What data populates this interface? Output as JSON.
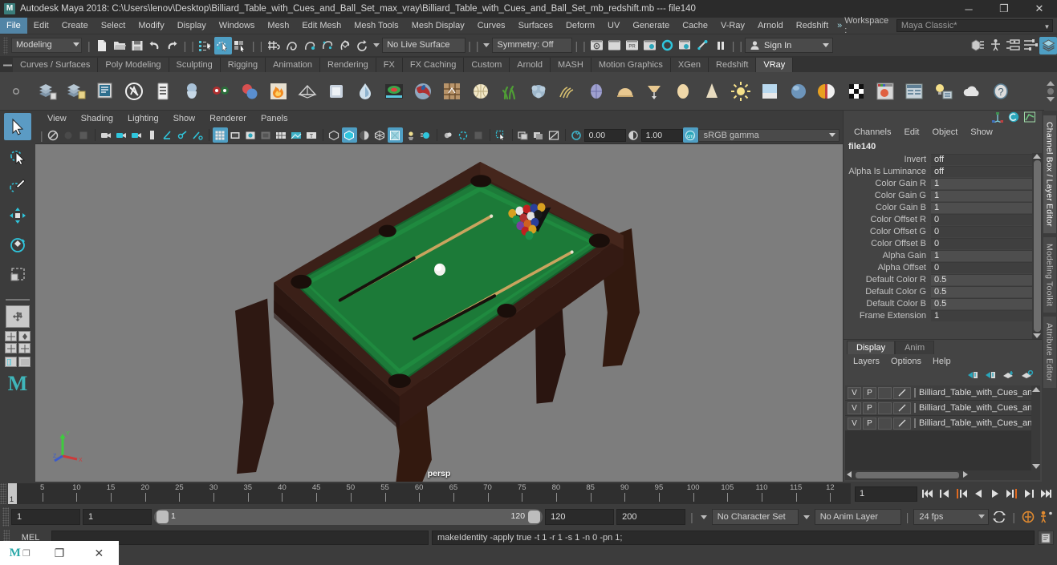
{
  "titlebar": {
    "app_icon": "maya-logo-icon",
    "title": "Autodesk Maya 2018: C:\\Users\\lenov\\Desktop\\Billiard_Table_with_Cues_and_Ball_Set_max_vray\\Billiard_Table_with_Cues_and_Ball_Set_mb_redshift.mb   ---  file140",
    "minimize": "─",
    "maximize": "❐",
    "close": "✕"
  },
  "menubar": {
    "items": [
      "File",
      "Edit",
      "Create",
      "Select",
      "Modify",
      "Display",
      "Windows",
      "Mesh",
      "Edit Mesh",
      "Mesh Tools",
      "Mesh Display",
      "Curves",
      "Surfaces",
      "Deform",
      "UV",
      "Generate",
      "Cache",
      "V-Ray",
      "Arnold",
      "Redshift"
    ],
    "active_index": 0,
    "overflow_chevron": "»",
    "workspace_label": "Workspace :",
    "workspace_value": "Maya Classic*",
    "lock_icon": "lock-icon"
  },
  "statusline": {
    "menuset": "Modeling",
    "no_live_surface": "No Live Surface",
    "symmetry": "Symmetry: Off",
    "signin": "Sign In",
    "icons": [
      "new-scene-icon",
      "open-scene-icon",
      "save-scene-icon",
      "undo-icon",
      "redo-icon",
      "select-by-hierarchy-icon",
      "select-by-object-icon",
      "select-by-component-icon",
      "snap-to-grid-icon",
      "snap-to-curve-icon",
      "snap-to-point-icon",
      "snap-to-projected-center-icon",
      "snap-to-view-plane-icon",
      "make-live-icon",
      "render-current-frame-icon",
      "ipr-render-icon",
      "render-settings-icon",
      "hypershade-icon",
      "render-view-icon",
      "render-sequence-icon",
      "pause-icon",
      "show-hide-editors-icon",
      "character-icon",
      "attribute-editor-icon",
      "tool-settings-icon",
      "channel-box-icon"
    ]
  },
  "shelf": {
    "tabs": [
      "Curves / Surfaces",
      "Poly Modeling",
      "Sculpting",
      "Rigging",
      "Animation",
      "Rendering",
      "FX",
      "FX Caching",
      "Custom",
      "Arnold",
      "MASH",
      "Motion Graphics",
      "XGen",
      "Redshift",
      "VRay"
    ],
    "active_tab": "VRay",
    "items": [
      {
        "name": "vray-render-icon"
      },
      {
        "name": "vray-render-save-icon"
      },
      {
        "name": "vray-frame-buffer-icon"
      },
      {
        "name": "vray-settings-icon"
      },
      {
        "name": "vray-vfb-icon"
      },
      {
        "name": "vray-proxy-icon"
      },
      {
        "name": "vray-stereo-icon"
      },
      {
        "name": "vray-material-icon"
      },
      {
        "name": "vray-fire-icon"
      },
      {
        "name": "vray-mesh-light-icon"
      },
      {
        "name": "vray-plane-icon"
      },
      {
        "name": "vray-water-icon"
      },
      {
        "name": "vray-displacement-icon"
      },
      {
        "name": "vray-blend-material-icon"
      },
      {
        "name": "vray-grid-icon"
      },
      {
        "name": "vray-dome-light-icon"
      },
      {
        "name": "vray-grass-icon"
      },
      {
        "name": "vray-fur-icon"
      },
      {
        "name": "vray-hair-icon"
      },
      {
        "name": "vray-sphere-light-icon"
      },
      {
        "name": "vray-dome-icon"
      },
      {
        "name": "vray-ies-light-icon"
      },
      {
        "name": "vray-sphere-icon"
      },
      {
        "name": "vray-cone-light-icon"
      },
      {
        "name": "vray-sun-icon"
      },
      {
        "name": "vray-sky-icon"
      },
      {
        "name": "vray-ball-icon"
      },
      {
        "name": "vray-toon-icon"
      },
      {
        "name": "vray-checker-icon"
      },
      {
        "name": "vray-material-preview-icon"
      },
      {
        "name": "vray-render-elements-icon"
      },
      {
        "name": "vray-light-lister-icon"
      },
      {
        "name": "vray-cloud-icon"
      },
      {
        "name": "vray-help-icon"
      }
    ]
  },
  "toolbox": {
    "tools": [
      "select-tool",
      "lasso-select-tool",
      "paint-select-tool",
      "move-tool",
      "rotate-tool",
      "scale-tool"
    ],
    "active_tool": "select-tool",
    "quick_layout": "single-perspective-layout-icon",
    "layout_cells": [
      "four-view-layout",
      "persp-outliner-layout",
      "persp-graph-layout",
      "persp-hypershade-layout"
    ],
    "maya_logo": "M"
  },
  "viewport": {
    "menus": [
      "View",
      "Shading",
      "Lighting",
      "Show",
      "Renderer",
      "Panels"
    ],
    "camera_label": "persp",
    "exposure": "0.00",
    "gamma": "1.00",
    "color_space": "sRGB gamma",
    "toolbar_icons": [
      "select-camera-icon",
      "lock-camera-icon",
      "camera-attributes-icon",
      "bookmark-icon",
      "image-plane-icon",
      "two-d-pan-zoom-icon",
      "grease-pencil-icon",
      "grid-toggle-icon",
      "film-gate-icon",
      "resolution-gate-icon",
      "gate-mask-icon",
      "wireframe-on-shaded-icon",
      "xray-icon",
      "xray-joints-icon",
      "shaded-icon",
      "smooth-shade-icon",
      "hardware-texturing-icon",
      "use-all-lights-icon",
      "shadows-icon",
      "screen-space-ao-icon",
      "motion-blur-icon",
      "multisample-icon",
      "isolate-select-icon",
      "viewport-render-icon",
      "exposure-icon",
      "gamma-icon",
      "color-management-icon"
    ],
    "axis_gizmo": {
      "x": "X",
      "y": "Y",
      "z": "Z",
      "x_color": "#cc3b3b",
      "y_color": "#3ecc3e",
      "z_color": "#3b5bcc"
    },
    "scene": {
      "background": "#7d7d7d",
      "table_cloth_color": "#1f7a3a",
      "table_wood_color": "#3d211a",
      "objects": [
        "billiard-table",
        "cue-stick-left",
        "cue-stick-right",
        "cue-ball",
        "ball-rack"
      ]
    }
  },
  "channelbox": {
    "tab_icons": [
      "show-manipulator-icon",
      "reference-icon",
      "graph-editor-icon"
    ],
    "menus": [
      "Channels",
      "Edit",
      "Object",
      "Show"
    ],
    "node_name": "file140",
    "channels": [
      {
        "name": "Invert",
        "value": "off",
        "dark": true
      },
      {
        "name": "Alpha Is Luminance",
        "value": "off",
        "dark": true
      },
      {
        "name": "Color Gain R",
        "value": "1",
        "dark": false
      },
      {
        "name": "Color Gain G",
        "value": "1",
        "dark": false
      },
      {
        "name": "Color Gain B",
        "value": "1",
        "dark": false
      },
      {
        "name": "Color Offset R",
        "value": "0",
        "dark": true
      },
      {
        "name": "Color Offset G",
        "value": "0",
        "dark": true
      },
      {
        "name": "Color Offset B",
        "value": "0",
        "dark": true
      },
      {
        "name": "Alpha Gain",
        "value": "1",
        "dark": false
      },
      {
        "name": "Alpha Offset",
        "value": "0",
        "dark": true
      },
      {
        "name": "Default Color R",
        "value": "0.5",
        "dark": false
      },
      {
        "name": "Default Color G",
        "value": "0.5",
        "dark": false
      },
      {
        "name": "Default Color B",
        "value": "0.5",
        "dark": false
      },
      {
        "name": "Frame Extension",
        "value": "1",
        "dark": true
      }
    ]
  },
  "layereditor": {
    "tabs": [
      "Display",
      "Anim"
    ],
    "active_tab": "Display",
    "menus": [
      "Layers",
      "Options",
      "Help"
    ],
    "buttons": [
      "move-layer-up-icon",
      "move-layer-down-icon",
      "new-layer-icon",
      "new-layer-from-selection-icon"
    ],
    "layers": [
      {
        "v": "V",
        "p": "P",
        "swatch": "",
        "name": "Billiard_Table_with_Cues_an"
      },
      {
        "v": "V",
        "p": "P",
        "swatch": "",
        "name": "Billiard_Table_with_Cues_an"
      },
      {
        "v": "V",
        "p": "P",
        "swatch": "",
        "name": "Billiard_Table_with_Cues_an"
      }
    ]
  },
  "vertical_tabs": {
    "items": [
      "Channel Box / Layer Editor",
      "Modeling Toolkit",
      "Attribute Editor"
    ],
    "active": "Channel Box / Layer Editor"
  },
  "timeslider": {
    "tick_labels": [
      "5",
      "10",
      "15",
      "20",
      "25",
      "30",
      "35",
      "40",
      "45",
      "50",
      "55",
      "60",
      "65",
      "70",
      "75",
      "80",
      "85",
      "90",
      "95",
      "100",
      "105",
      "110",
      "115",
      "12"
    ],
    "start_frame": "1",
    "current_frame": "1",
    "playback_buttons": [
      "go-to-start-icon",
      "step-back-key-icon",
      "step-back-frame-icon",
      "play-backwards-icon",
      "play-forwards-icon",
      "step-forward-frame-icon",
      "step-forward-key-icon",
      "go-to-end-icon"
    ]
  },
  "rangeslider": {
    "anim_start": "1",
    "range_start": "1",
    "bar_min": "1",
    "bar_max": "120",
    "range_end": "120",
    "anim_end": "200",
    "character_set": "No Character Set",
    "anim_layer": "No Anim Layer",
    "fps": "24 fps",
    "icons": [
      "auto-key-icon",
      "animation-preferences-icon",
      "loop-playback-icon"
    ]
  },
  "commandline": {
    "label": "MEL",
    "input_value": "",
    "output": "makeIdentity -apply true -t 1 -r 1 -s 1 -n 0 -pn 1;",
    "script_editor_icon": "script-editor-icon"
  },
  "taskbar": {
    "items": [
      "maya-window-icon",
      "restore-icon",
      "close-icon"
    ]
  }
}
